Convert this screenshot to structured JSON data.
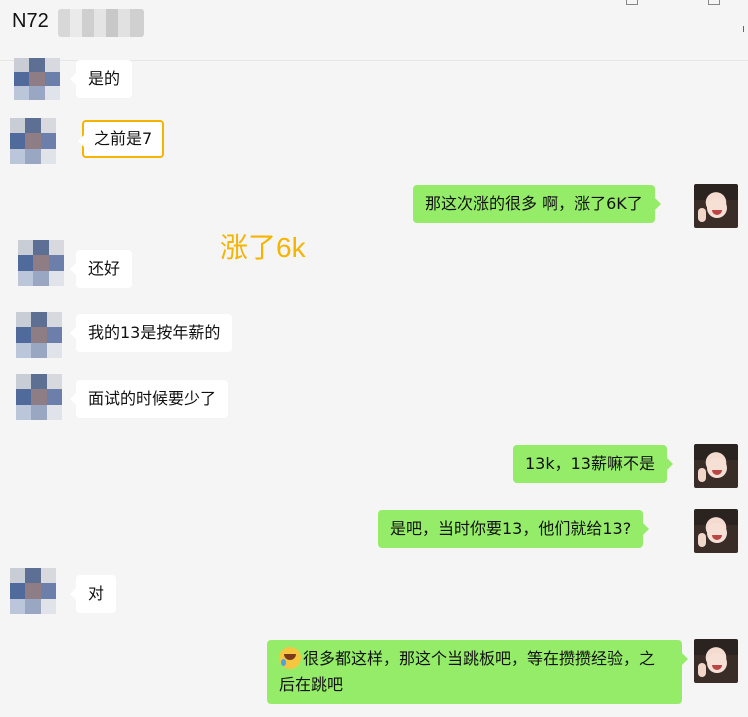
{
  "header": {
    "title": "N72"
  },
  "annotation": "涨了6k",
  "messages": [
    {
      "side": "in",
      "text": "是的"
    },
    {
      "side": "in",
      "text": "之前是7",
      "highlighted": true
    },
    {
      "side": "out",
      "text": "那这次涨的很多 啊，涨了6K了"
    },
    {
      "side": "in",
      "text": "还好"
    },
    {
      "side": "in",
      "text": "我的13是按年薪的"
    },
    {
      "side": "in",
      "text": "面试的时候要少了"
    },
    {
      "side": "out",
      "text": "13k，13薪嘛不是"
    },
    {
      "side": "out",
      "text": "是吧，当时你要13，他们就给13?"
    },
    {
      "side": "in",
      "text": "对"
    },
    {
      "side": "out",
      "emoji": "laughing-crying-emoji",
      "text": "很多都这样，那这个当跳板吧，等在攒攒经验，之后在跳吧"
    }
  ],
  "colors": {
    "out_bubble": "#95ec69",
    "in_bubble": "#ffffff",
    "highlight": "#f5b400",
    "background": "#f5f5f5"
  }
}
